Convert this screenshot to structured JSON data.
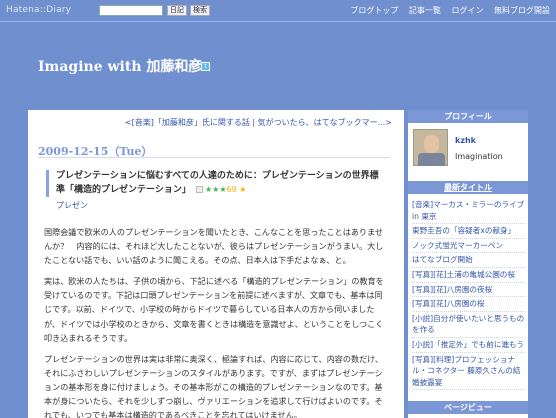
{
  "topbar": {
    "logo": "Hatena::Diary",
    "search_value": "",
    "btn_diary": "日記",
    "btn_search": "検索",
    "links": [
      "ブログトップ",
      "記事一覧",
      "ログイン",
      "無料ブログ開設"
    ]
  },
  "header": {
    "title": "Imagine with 加藤和彦",
    "rss1": "rss",
    "rss2": "rss",
    "twitter": "t"
  },
  "main": {
    "nav_prev": "<[音楽]「加藤和彦」氏に関する話",
    "nav_sep": "|",
    "nav_next": "気がついたら、はてなブックマー...>",
    "date": "2009-12-15（Tue）",
    "entry": {
      "title": "プレゼンテーションに悩むすべての人達のために：プレゼンテーションの世界標準「構造的プレゼンテーション」",
      "stars_green": "★★★",
      "stars_count": "69",
      "stars_yellow": "★",
      "category": "プレゼン",
      "paragraphs": [
        "国際会議で欧米の人のプレゼンテーションを聞いたとき、こんなことを思ったことはありませんか？　内容的には、それほど大したことないが、彼らはプレゼンテーションがうまい。大したことない話でも、いい話のように聞こえる。その点、日本人は下手だよなぁ、と。",
        "実は、欧米の人たちは、子供の頃から、下記に述べる「構造的プレゼンテーション」の教育を受けているのです。下記は口頭プレゼンテーションを前提に述べますが、文章でも、基本は同じです。以前、ドイツで、小学校の時からドイツで暮らしている日本人の方から伺いましたが、ドイツでは小学校のときから、文章を書くときは構造を意識せよ、ということをしつこく叩き込まれるそうです。",
        "プレゼンテーションの世界は実は非常に奥深く、極論すれば、内容に応じて、内容の数だけ、それにふさわしいプレゼンテーションのスタイルがあります。ですが、まずはプレゼンテーションの基本形を身に付けましょう。その基本形がこの構造的プレゼンテーションなのです。基本が身についたら、それを少しずつ崩し、ヴァリエーションを追求して行けばよいのです。それでも、いつでも基本は構造的であるべきことを忘れてはいけません。"
      ]
    }
  },
  "side": {
    "profile_header": "プロフィール",
    "profile_name": "kzhk",
    "profile_text": "Imagination",
    "recent_header": "最新タイトル",
    "recent": [
      "[音楽]マーカス・ミラーのライブ in 東京",
      "東野圭吾の「容疑者xの献身」",
      "ノック式蛍光マーカーペン",
      "はてなブログ開始",
      "[写真][花]土浦の亀城公園の桜",
      "[写真][花]八房園の夜桜",
      "[写真][花]八房園の桜",
      "[小説]自分が使いたいと思うものを作る",
      "[小説]「推定外」でも前に進もう",
      "[写真][料理]プロフェッショナル・コネクター 藤原久さんの結婚披露宴"
    ],
    "pageview_header": "ページビュー"
  }
}
